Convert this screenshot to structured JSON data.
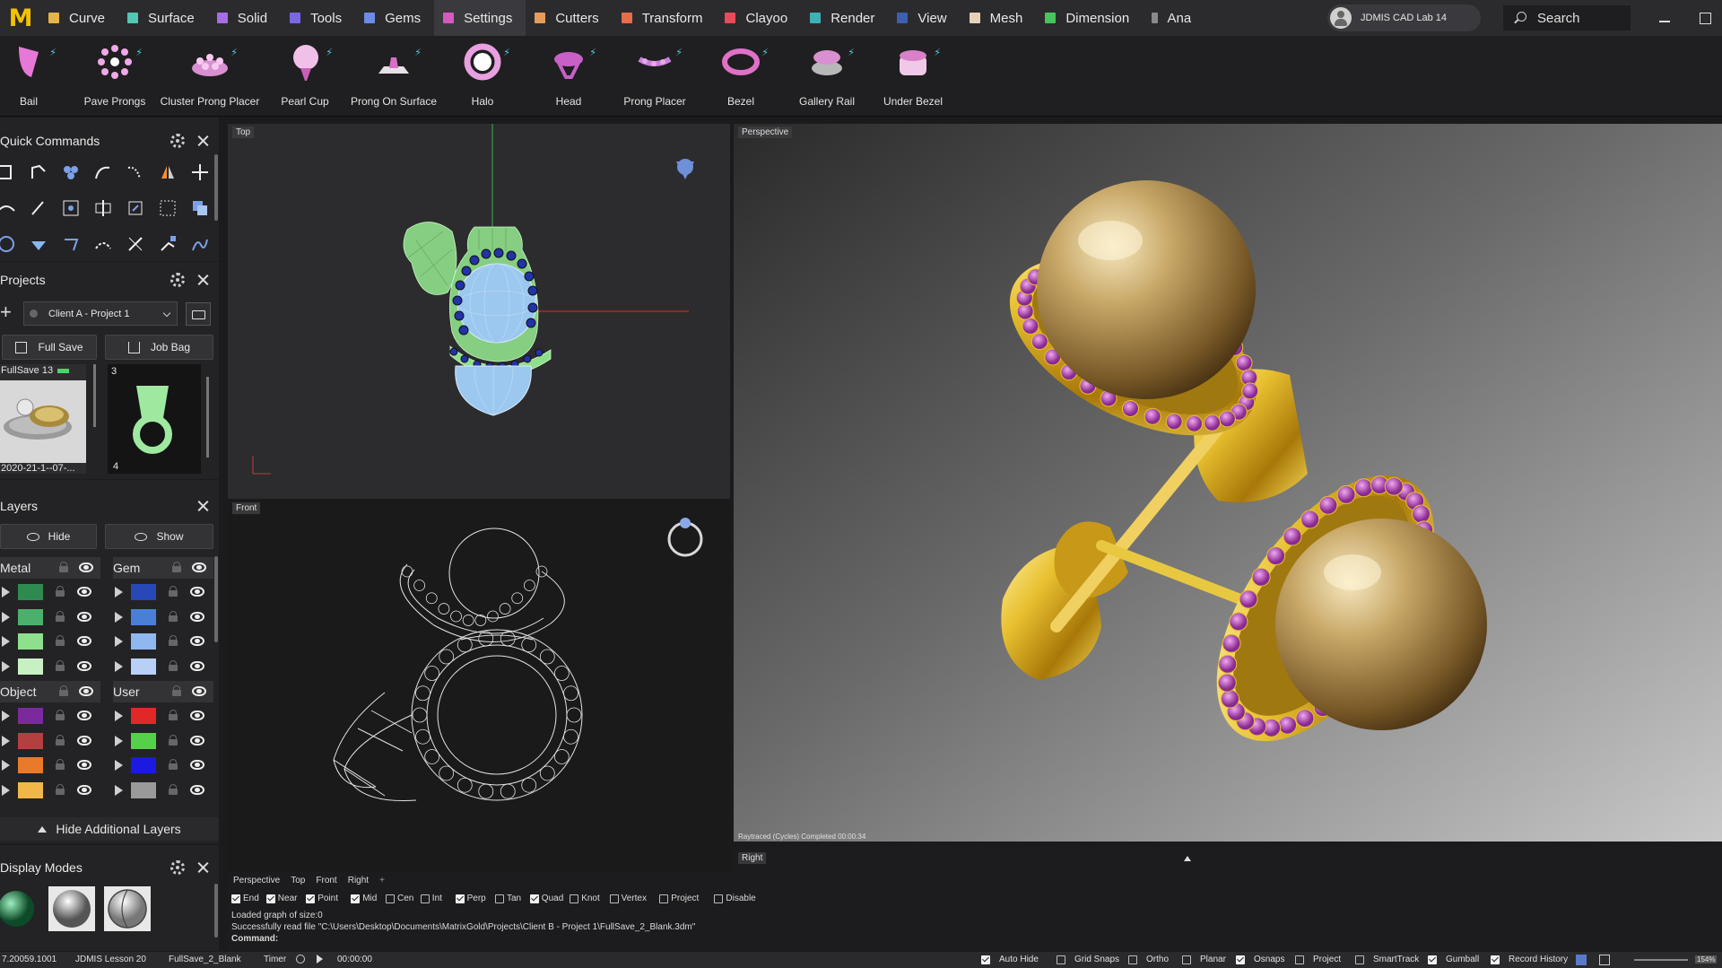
{
  "app": {
    "logo_letter": "M",
    "menu_tabs": [
      {
        "label": "Curve",
        "color": "#e6b34c"
      },
      {
        "label": "Surface",
        "color": "#53c7b5"
      },
      {
        "label": "Solid",
        "color": "#a66de6"
      },
      {
        "label": "Tools",
        "color": "#7a67e6"
      },
      {
        "label": "Gems",
        "color": "#6b8be6"
      },
      {
        "label": "Settings",
        "color": "#d55ac0"
      },
      {
        "label": "Cutters",
        "color": "#e69b5c"
      },
      {
        "label": "Transform",
        "color": "#e66c4c"
      },
      {
        "label": "Clayoo",
        "color": "#e64c5a"
      },
      {
        "label": "Render",
        "color": "#3fb0b5"
      },
      {
        "label": "View",
        "color": "#3d5fb0"
      },
      {
        "label": "Mesh",
        "color": "#e8d0b8"
      },
      {
        "label": "Dimension",
        "color": "#47c45a"
      },
      {
        "label": "Ana",
        "color": "#8a8a8a"
      }
    ],
    "active_tab": "Settings",
    "user_name": "JDMIS CAD Lab 14",
    "search_placeholder": "Search"
  },
  "ribbon": {
    "items": [
      {
        "label": "Bail",
        "icon": "bail-icon"
      },
      {
        "label": "Pave Prongs",
        "icon": "pave-prongs-icon"
      },
      {
        "label": "Cluster Prong Placer",
        "icon": "cluster-prong-icon"
      },
      {
        "label": "Pearl Cup",
        "icon": "pearl-cup-icon"
      },
      {
        "label": "Prong On Surface",
        "icon": "prong-surface-icon"
      },
      {
        "label": "Halo",
        "icon": "halo-icon"
      },
      {
        "label": "Head",
        "icon": "head-icon"
      },
      {
        "label": "Prong Placer",
        "icon": "prong-placer-icon"
      },
      {
        "label": "Bezel",
        "icon": "bezel-icon"
      },
      {
        "label": "Gallery Rail",
        "icon": "gallery-rail-icon"
      },
      {
        "label": "Under Bezel",
        "icon": "under-bezel-icon"
      }
    ]
  },
  "quick_commands": {
    "title": "Quick Commands"
  },
  "projects": {
    "title": "Projects",
    "selected_project": "Client A - Project 1",
    "full_save_label": "Full Save",
    "job_bag_label": "Job Bag",
    "thumbs": [
      {
        "badge": "FullSave 13",
        "caption": "2020-21-1--07-..."
      },
      {
        "badge": "3",
        "caption": "4"
      }
    ]
  },
  "layers": {
    "title": "Layers",
    "hide_label": "Hide",
    "show_label": "Show",
    "groups": [
      {
        "name": "Metal",
        "colors": [
          "#2f8a4f",
          "#4bb06b",
          "#8ee08c",
          "#c8f0c4"
        ]
      },
      {
        "name": "Gem",
        "colors": [
          "#2848b8",
          "#4a7fd8",
          "#8fb7f0",
          "#b8d0f8"
        ]
      },
      {
        "name": "Object",
        "colors": [
          "#7a2a9c",
          "#b34040",
          "#e87a2a",
          "#f0b848"
        ]
      },
      {
        "name": "User",
        "colors": [
          "#e02828",
          "#56d048",
          "#1a1ae0",
          "#9a9a9a"
        ]
      }
    ],
    "hide_additional_label": "Hide Additional Layers"
  },
  "display_modes": {
    "title": "Display Modes"
  },
  "viewports": {
    "top_label": "Top",
    "front_label": "Front",
    "perspective_label": "Perspective",
    "right_label": "Right",
    "render_status": "Raytraced (Cycles)   Completed    00:00:34"
  },
  "viewport_tabs": [
    "Perspective",
    "Top",
    "Front",
    "Right"
  ],
  "snaps": [
    {
      "label": "End",
      "on": true
    },
    {
      "label": "Near",
      "on": true
    },
    {
      "label": "Point",
      "on": true
    },
    {
      "label": "Mid",
      "on": true
    },
    {
      "label": "Cen",
      "on": false
    },
    {
      "label": "Int",
      "on": false
    },
    {
      "label": "Perp",
      "on": true
    },
    {
      "label": "Tan",
      "on": false
    },
    {
      "label": "Quad",
      "on": true
    },
    {
      "label": "Knot",
      "on": false
    },
    {
      "label": "Vertex",
      "on": false
    },
    {
      "label": "Project",
      "on": false
    },
    {
      "label": "Disable",
      "on": false
    }
  ],
  "command_history": [
    "Loaded graph of size:0",
    "Successfully read file \"C:\\Users\\Desktop\\Documents\\MatrixGold\\Projects\\Client B - Project 1\\FullSave_2_Blank.3dm\""
  ],
  "command_prompt": "Command:",
  "status": {
    "version": "7.20059.1001",
    "lesson": "JDMIS Lesson 20",
    "file": "FullSave_2_Blank",
    "timer_label": "Timer",
    "timer_value": "00:00:00",
    "toggles": [
      {
        "label": "Auto Hide",
        "on": true
      },
      {
        "label": "Grid Snaps",
        "on": false
      },
      {
        "label": "Ortho",
        "on": false
      },
      {
        "label": "Planar",
        "on": false
      },
      {
        "label": "Osnaps",
        "on": true
      },
      {
        "label": "Project",
        "on": false
      },
      {
        "label": "SmartTrack",
        "on": false
      },
      {
        "label": "Gumball",
        "on": true
      },
      {
        "label": "Record History",
        "on": true
      }
    ],
    "zoom": "154%"
  }
}
